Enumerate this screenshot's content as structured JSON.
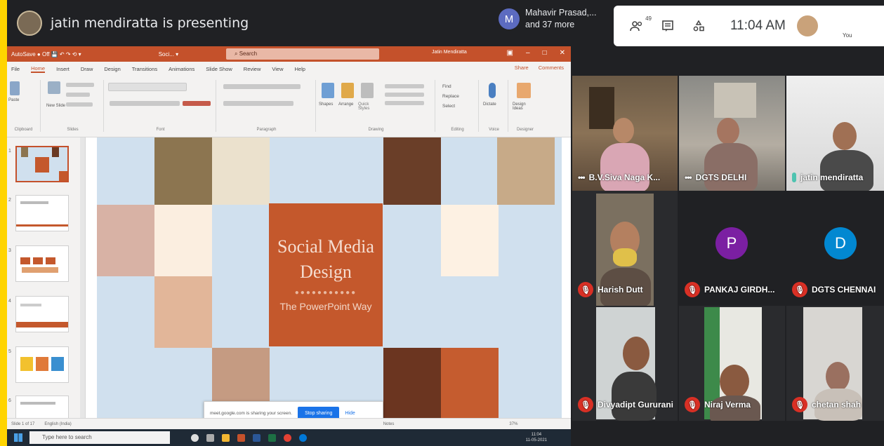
{
  "topbar": {
    "presenter_text": "jatin mendiratta is presenting",
    "participants_initial": "M",
    "participants_line1": "Mahavir Prasad,...",
    "participants_line2": "and 37 more",
    "people_count": "49",
    "clock": "11:04 AM",
    "you_label": "You"
  },
  "powerpoint": {
    "title_left": "AutoSave ● Off  💾 ↶ ↷ ⟲ ▾",
    "file_name": "Soci...  ▾",
    "search_placeholder": "Search",
    "user": "Jatin Mendiratta",
    "tabs": [
      "File",
      "Home",
      "Insert",
      "Draw",
      "Design",
      "Transitions",
      "Animations",
      "Slide Show",
      "Review",
      "View",
      "Help"
    ],
    "active_tab": "Home",
    "share_label": "Share",
    "comments_label": "Comments",
    "ribbon_groups": [
      "Clipboard",
      "Slides",
      "Font",
      "Paragraph",
      "Drawing",
      "Editing",
      "Voice",
      "Designer"
    ],
    "ribbon_buttons": {
      "paste": "Paste",
      "new_slide": "New Slide",
      "shapes": "Shapes",
      "arrange": "Arrange",
      "quick_styles": "Quick Styles",
      "find": "Find",
      "replace": "Replace",
      "select": "Select",
      "dictate": "Dictate",
      "design_ideas": "Design Ideas"
    },
    "slide_numbers": [
      "1",
      "2",
      "3",
      "4",
      "5",
      "6"
    ],
    "slide_title_line1": "Social Media",
    "slide_title_line2": "Design",
    "slide_dots": "●●●●●●●●●●●",
    "slide_subtitle": "The PowerPoint Way",
    "sharing_text": "meet.google.com is sharing your screen.",
    "stop_sharing": "Stop sharing",
    "hide": "Hide",
    "status_slide": "Slide 1 of 17",
    "status_lang": "English (India)",
    "status_notes": "Notes",
    "status_zoom": "37%"
  },
  "taskbar": {
    "search_placeholder": "Type here to search",
    "time": "11:04",
    "date": "11-05-2021"
  },
  "participants": [
    {
      "name": "B.V.Siva Naga K...",
      "status": "more"
    },
    {
      "name": "DGTS DELHI",
      "status": "more"
    },
    {
      "name": "jatin mendiratta",
      "status": "speaking"
    },
    {
      "name": "Harish Dutt",
      "status": "muted"
    },
    {
      "name": "PANKAJ GIRDH...",
      "status": "muted",
      "initial": "P",
      "color": "#7b1fa2"
    },
    {
      "name": "DGTS CHENNAI",
      "status": "muted",
      "initial": "D",
      "color": "#0288d1"
    },
    {
      "name": "Divyadipt Gururani",
      "status": "muted"
    },
    {
      "name": "Niraj Verma",
      "status": "muted"
    },
    {
      "name": "chetan shah",
      "status": "muted"
    }
  ],
  "colors": {
    "accent_orange": "#c4512b",
    "meet_dark": "#202124",
    "mute_red": "#d93025",
    "highlight_yellow": "#ffd400"
  }
}
